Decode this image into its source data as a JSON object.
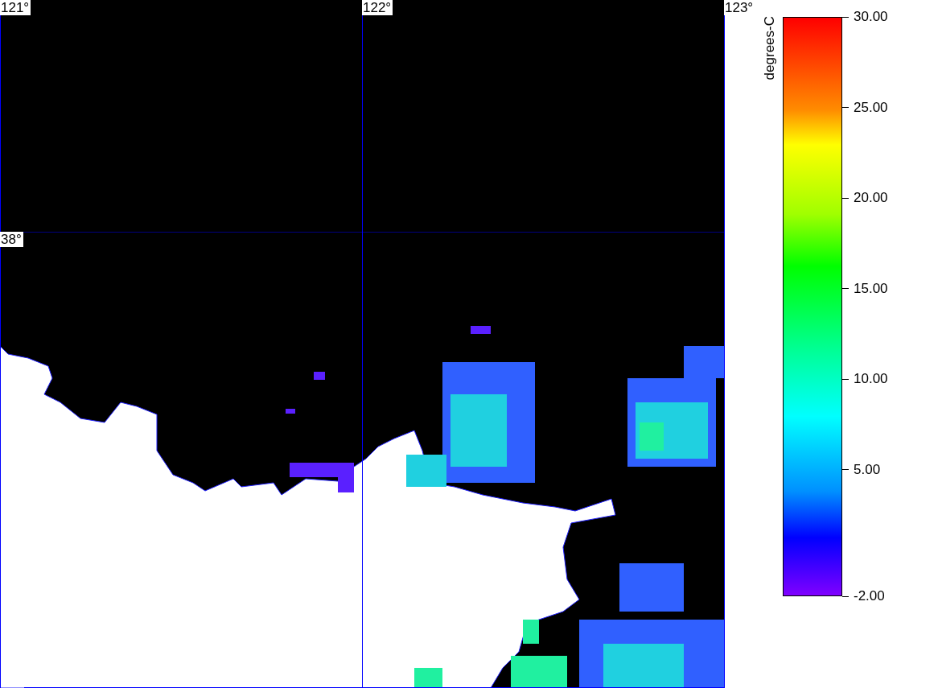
{
  "map": {
    "longitude_labels": [
      "121°",
      "122°",
      "123°"
    ],
    "latitude_labels": [
      "38°"
    ]
  },
  "legend": {
    "unit": "degrees-C",
    "ticks": [
      "30.00",
      "25.00",
      "20.00",
      "15.00",
      "10.00",
      "5.00",
      "-2.00"
    ]
  }
}
